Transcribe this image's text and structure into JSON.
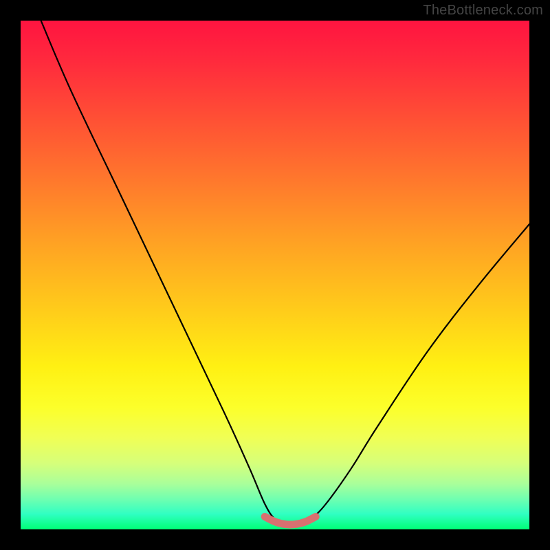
{
  "watermark": "TheBottleneck.com",
  "chart_data": {
    "type": "line",
    "title": "",
    "xlabel": "",
    "ylabel": "",
    "xlim": [
      0,
      100
    ],
    "ylim": [
      0,
      100
    ],
    "series": [
      {
        "name": "bottleneck-curve",
        "x": [
          4,
          10,
          20,
          30,
          40,
          45,
          48,
          50,
          52,
          55,
          57,
          60,
          65,
          70,
          80,
          90,
          100
        ],
        "values": [
          100,
          86,
          65,
          44,
          23,
          12,
          5,
          2,
          1,
          1,
          2,
          5,
          12,
          20,
          35,
          48,
          60
        ]
      },
      {
        "name": "flat-bottom-marker",
        "x": [
          48,
          50,
          52,
          54,
          56,
          58
        ],
        "values": [
          2.5,
          1.5,
          1,
          1,
          1.5,
          2.5
        ]
      }
    ],
    "gradient_stops": [
      {
        "pct": 0,
        "color": "#ff1440"
      },
      {
        "pct": 50,
        "color": "#ffc000"
      },
      {
        "pct": 80,
        "color": "#fff000"
      },
      {
        "pct": 100,
        "color": "#00ff76"
      }
    ]
  }
}
